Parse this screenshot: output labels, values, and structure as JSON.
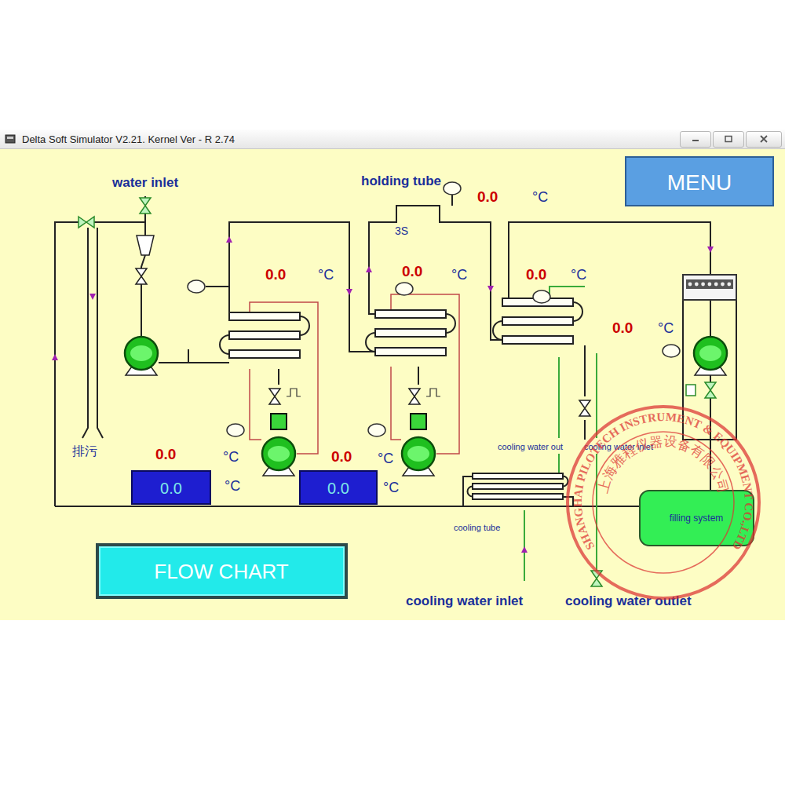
{
  "window": {
    "title": "Delta Soft Simulator V2.21. Kernel Ver - R 2.74"
  },
  "menu_button": "MENU",
  "flow_chart_button": "FLOW CHART",
  "filling_system_button": "filling system",
  "labels": {
    "water_inlet": "water inlet",
    "holding_tube": "holding tube",
    "holding_time": "3S",
    "drain": "排污",
    "cooling_water_out": "cooling water out",
    "cooling_water_in_small": "cooling water inlet",
    "cooling_tube": "cooling tube",
    "cooling_water_inlet": "cooling water inlet",
    "cooling_water_outlet": "cooling water outlet"
  },
  "readings": [
    {
      "value": "0.0",
      "unit": "°C"
    },
    {
      "value": "0.0",
      "unit": "°C"
    },
    {
      "value": "0.0",
      "unit": "°C"
    },
    {
      "value": "0.0",
      "unit": "°C"
    },
    {
      "value": "0.0",
      "unit": "°C"
    },
    {
      "value": "0.0",
      "unit": "°C"
    },
    {
      "value": "0.0",
      "unit": "°C"
    }
  ],
  "setpoints": [
    {
      "value": "0.0",
      "unit": "°C"
    },
    {
      "value": "0.0",
      "unit": "°C"
    }
  ],
  "stamp": {
    "outer_text": "SHANGHAI PILOTECH INSTRUMENT & EQUIPMENT CO.,LTD",
    "inner_text": "上海雅程仪器设备有限公司"
  }
}
